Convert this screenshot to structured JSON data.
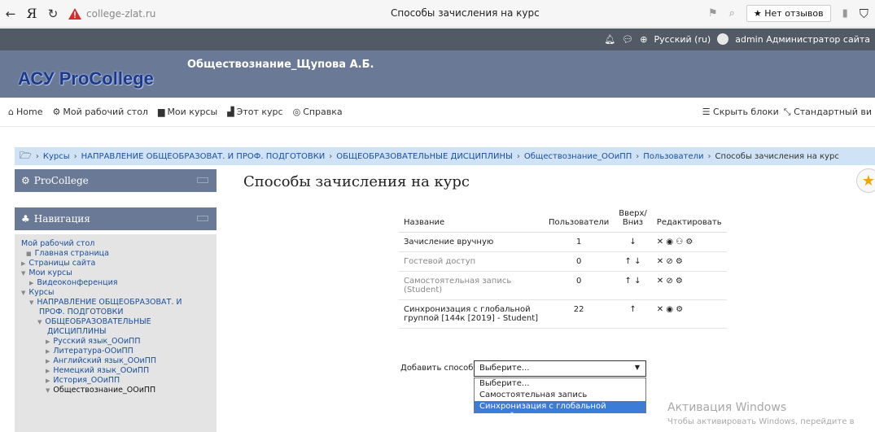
{
  "browser": {
    "brand": "Я",
    "url": "college-zlat.ru",
    "tab_title": "Способы зачисления на курс",
    "reviews_label": "★ Нет отзывов"
  },
  "topbar": {
    "language": "Русский (ru)",
    "user": "admin Администратор сайта"
  },
  "header": {
    "logo": "АСУ ProCollege",
    "course_title": "Обществознание_Щупова А.Б."
  },
  "navbar": {
    "items": [
      {
        "icon": "home-icon",
        "label": "Home"
      },
      {
        "icon": "dashboard-icon",
        "label": "Мой рабочий стол"
      },
      {
        "icon": "courses-icon",
        "label": "Мои курсы"
      },
      {
        "icon": "course-icon",
        "label": "Этот курс"
      },
      {
        "icon": "help-icon",
        "label": "Справка"
      }
    ],
    "hide_blocks": "Скрыть блоки",
    "standard_view": "Стандартный ви"
  },
  "breadcrumb": [
    "Курсы",
    "НАПРАВЛЕНИЕ ОБЩЕОБРАЗОВАТ. И ПРОФ. ПОДГОТОВКИ",
    "ОБЩЕОБРАЗОВАТЕЛЬНЫЕ ДИСЦИПЛИНЫ",
    "Обществознание_ООиПП",
    "Пользователи",
    "Способы зачисления на курс"
  ],
  "blocks": {
    "procollege": "ProCollege",
    "navigation": "Навигация"
  },
  "nav_tree": {
    "dashboard": "Мой рабочий стол",
    "home": "Главная страница",
    "site_pages": "Страницы сайта",
    "my_courses": "Мои курсы",
    "videoconf": "Видеоконференция",
    "courses": "Курсы",
    "direction_1": "НАПРАВЛЕНИЕ ОБЩЕОБРАЗОВАТ. И",
    "direction_2": "ПРОФ. ПОДГОТОВКИ",
    "general_1": "ОБЩЕОБРАЗОВАТЕЛЬНЫЕ",
    "general_2": "ДИСЦИПЛИНЫ",
    "c1": "Русский язык_ООиПП",
    "c2": "Литература-ООиПП",
    "c3": "Английский язык_ООиПП",
    "c4": "Немецкий язык_ООиПП",
    "c5": "История_ООиПП",
    "c6": "Обществознание_ООиПП"
  },
  "main": {
    "title": "Способы зачисления на курс",
    "columns": {
      "name": "Название",
      "users": "Пользователи",
      "move_1": "Вверх/",
      "move_2": "Вниз",
      "edit": "Редактировать"
    },
    "rows": [
      {
        "name": "Зачисление вручную",
        "users": "1",
        "move": "↓",
        "edit": "✕ ◉ ⚇ ⚙"
      },
      {
        "name": "Гостевой доступ",
        "users": "0",
        "move": "↑ ↓",
        "edit": "✕ ⊘ ⚙"
      },
      {
        "name": "Самостоятельная запись (Student)",
        "users": "0",
        "move": "↑ ↓",
        "edit": "✕ ⊘ ⚙"
      },
      {
        "name": "Синхронизация с глобальной группой [144к [2019] - Student]",
        "users": "22",
        "move": "↑",
        "edit": "✕ ◉ ⚙"
      }
    ],
    "add_label": "Добавить способ",
    "select_value": "Выберите...",
    "options": [
      "Выберите...",
      "Самостоятельная запись",
      "Синхронизация с глобальной группой"
    ]
  },
  "windows": {
    "line1": "Активация Windows",
    "line2": "Чтобы активировать Windows, перейдите в"
  }
}
